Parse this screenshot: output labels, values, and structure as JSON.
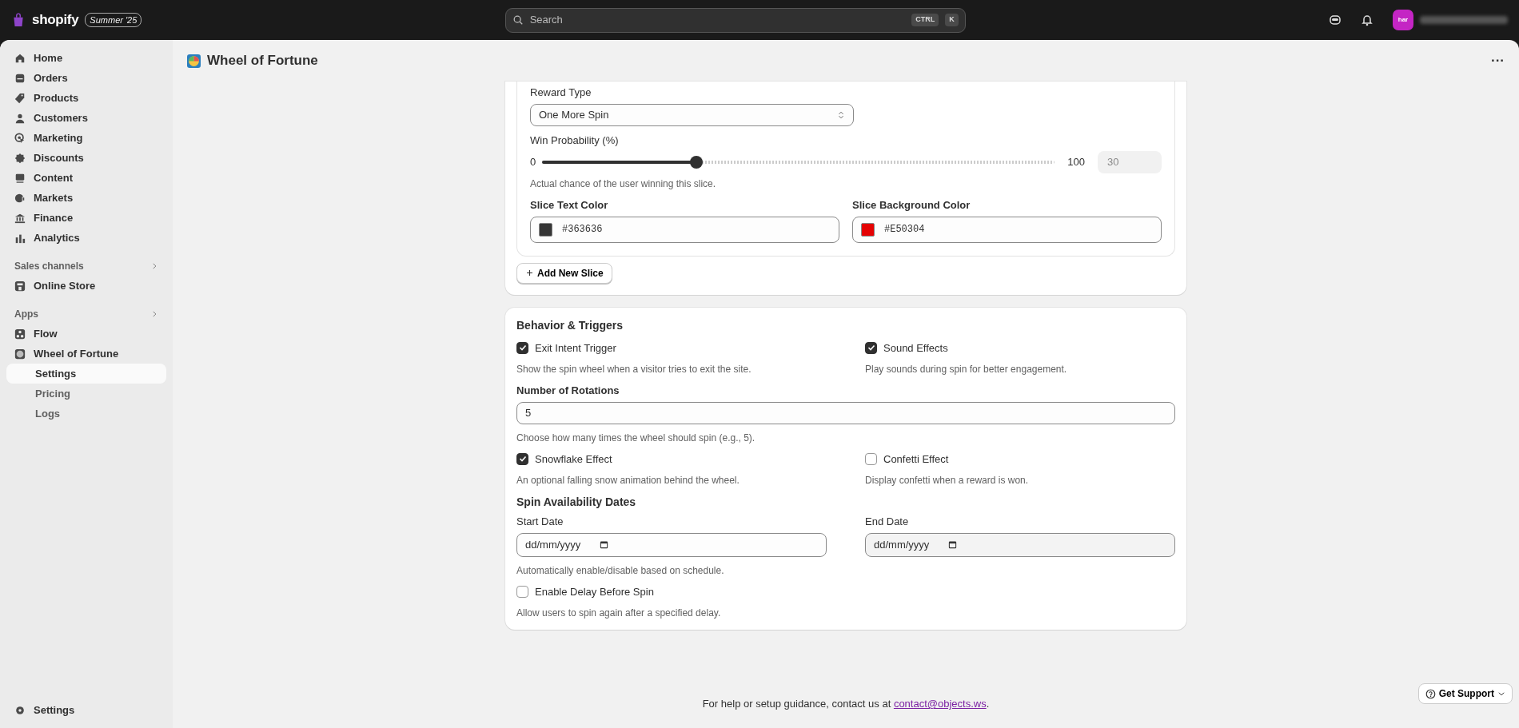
{
  "topbar": {
    "logo": "shopify",
    "edition": "Summer '25",
    "search": {
      "placeholder": "Search",
      "keys": [
        "CTRL",
        "K"
      ]
    },
    "avatar": "har"
  },
  "sidebar": {
    "items": [
      {
        "label": "Home",
        "selected": false
      },
      {
        "label": "Orders",
        "selected": false
      },
      {
        "label": "Products",
        "selected": false
      },
      {
        "label": "Customers",
        "selected": false
      },
      {
        "label": "Marketing",
        "selected": false
      },
      {
        "label": "Discounts",
        "selected": false
      },
      {
        "label": "Content",
        "selected": false
      },
      {
        "label": "Markets",
        "selected": false
      },
      {
        "label": "Finance",
        "selected": false
      },
      {
        "label": "Analytics",
        "selected": false
      }
    ],
    "sections": [
      {
        "title": "Sales channels",
        "items": [
          {
            "label": "Online Store",
            "selected": false
          }
        ]
      },
      {
        "title": "Apps",
        "items": [
          {
            "label": "Flow",
            "selected": false
          },
          {
            "label": "Wheel of Fortune",
            "selected": false,
            "children": [
              {
                "label": "Settings",
                "selected": true
              },
              {
                "label": "Pricing",
                "selected": false
              },
              {
                "label": "Logs",
                "selected": false
              }
            ]
          }
        ]
      }
    ],
    "footer_item": "Settings"
  },
  "page": {
    "title": "Wheel of Fortune",
    "more": "···",
    "slice": {
      "reward_label": "Reward Type",
      "reward_value": "One More Spin",
      "probability_label": "Win Probability (%)",
      "min": "0",
      "max": "100",
      "level": 0.3,
      "probability_value": "30",
      "probability_help": "Actual chance of the user winning this slice.",
      "colors": [
        {
          "label": "Slice Text Color",
          "value": "#363636",
          "color": "#363636"
        },
        {
          "label": "Slice Background Color",
          "value": "#E50304",
          "color": "#e50304"
        }
      ]
    },
    "add_slice_button": "Add New Slice",
    "behavior": {
      "title": "Behavior & Triggers",
      "toggles_top": [
        {
          "label": "Exit Intent Trigger",
          "checked": true,
          "help": "Show the spin wheel when a visitor tries to exit the site."
        },
        {
          "label": "Sound Effects",
          "checked": true,
          "help": "Play sounds during spin for better engagement."
        }
      ],
      "rotations_label": "Number of Rotations",
      "rotations_value": "5",
      "rotations_help": "Choose how many times the wheel should spin (e.g., 5).",
      "toggles_mid": [
        {
          "label": "Snowflake Effect",
          "checked": true,
          "help": "An optional falling snow animation behind the wheel."
        },
        {
          "label": "Confetti Effect",
          "checked": false,
          "help": "Display confetti when a reward is won."
        }
      ],
      "dates_title": "Spin Availability Dates",
      "dates": [
        {
          "label": "Start Date",
          "placeholder": "dd/mm/yyyy"
        },
        {
          "label": "End Date",
          "placeholder": "dd/mm/yyyy"
        }
      ],
      "dates_help": "Automatically enable/disable based on schedule.",
      "delay": {
        "label": "Enable Delay Before Spin",
        "checked": false,
        "help": "Allow users to spin again after a specified delay."
      }
    }
  },
  "footer": {
    "text": "For help or setup guidance, contact us at ",
    "link": "contact@objects.ws",
    "end": "."
  },
  "support_button": "Get Support"
}
